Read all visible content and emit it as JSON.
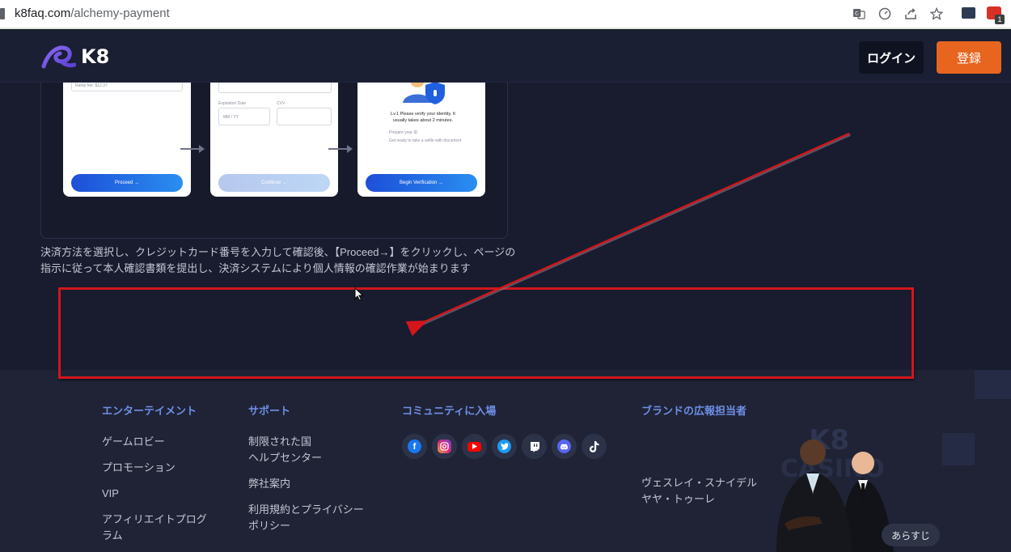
{
  "browser": {
    "url_domain": "k8faq.com",
    "url_path": "/alchemy-payment",
    "extension_badge_count": "1"
  },
  "header": {
    "logo_text": "K8",
    "login_label": "ログイン",
    "register_label": "登録"
  },
  "illustration": {
    "screen1": {
      "fee_text": "Ramp fee: $12.37",
      "button_label": "Proceed →"
    },
    "screen2": {
      "expiration_label": "Expiration Date",
      "cvv_label": "CVV",
      "expiry_placeholder": "MM / YY",
      "button_label": "Continue →"
    },
    "screen3": {
      "verify_text": "Lv.1 Please verify your identity. It usually takes about 2 minutes.",
      "step1": "· Prepare your ID",
      "step2": "· Get ready to take a selfie with document",
      "button_label": "Begin Verification →"
    }
  },
  "description": "決済方法を選択し、クレジットカード番号を入力して確認後、【Proceed→】をクリックし、ページの指示に従って本人確認書類を提出し、決済システムにより個人情報の確認作業が始まります",
  "footer": {
    "entertainment": {
      "heading": "エンターテイメント",
      "links": [
        "ゲームロビー",
        "プロモーション",
        "VIP",
        "アフィリエイトプログラム"
      ]
    },
    "support": {
      "heading": "サポート",
      "links": [
        "制限された国\nヘルプセンター",
        "弊社案内",
        "利用規約とプライバシーポリシー"
      ]
    },
    "community": {
      "heading": "コミュニティに入場",
      "icons": [
        "facebook-icon",
        "instagram-icon",
        "youtube-icon",
        "twitter-icon",
        "twitch-icon",
        "discord-icon",
        "tiktok-icon"
      ]
    },
    "ambassadors": {
      "heading": "ブランドの広報担当者",
      "names": [
        "ヴェスレイ・スナイデル",
        "ヤヤ・トゥーレ"
      ],
      "synopsis_label": "あらすじ"
    }
  },
  "colors": {
    "accent_orange": "#e8651f",
    "footer_heading_blue": "#6f8fe8",
    "annotation_red": "#d3161c"
  }
}
